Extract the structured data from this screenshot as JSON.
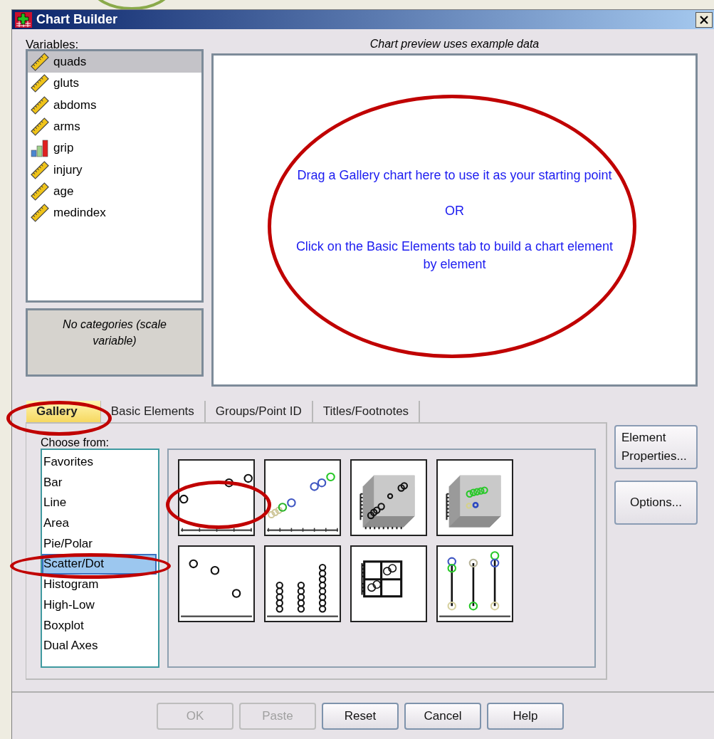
{
  "window": {
    "title": "Chart Builder"
  },
  "variables": {
    "label": "Variables:",
    "items": [
      {
        "name": "quads",
        "kind": "scale",
        "selected": true
      },
      {
        "name": "gluts",
        "kind": "scale",
        "selected": false
      },
      {
        "name": "abdoms",
        "kind": "scale",
        "selected": false
      },
      {
        "name": "arms",
        "kind": "scale",
        "selected": false
      },
      {
        "name": "grip",
        "kind": "ordinal",
        "selected": false
      },
      {
        "name": "injury",
        "kind": "scale",
        "selected": false
      },
      {
        "name": "age",
        "kind": "scale",
        "selected": false
      },
      {
        "name": "medindex",
        "kind": "scale",
        "selected": false
      }
    ],
    "categories_note": "No categories (scale variable)"
  },
  "preview": {
    "caption": "Chart preview uses example data",
    "lines": [
      "Drag a Gallery chart here to use it as your starting point",
      "OR",
      "Click on the Basic Elements tab to build a chart element by element"
    ]
  },
  "tabs": [
    {
      "label": "Gallery",
      "selected": true
    },
    {
      "label": "Basic Elements",
      "selected": false
    },
    {
      "label": "Groups/Point ID",
      "selected": false
    },
    {
      "label": "Titles/Footnotes",
      "selected": false
    }
  ],
  "gallery": {
    "label": "Choose from:",
    "types": [
      {
        "label": "Favorites",
        "selected": false
      },
      {
        "label": "Bar",
        "selected": false
      },
      {
        "label": "Line",
        "selected": false
      },
      {
        "label": "Area",
        "selected": false
      },
      {
        "label": "Pie/Polar",
        "selected": false
      },
      {
        "label": "Scatter/Dot",
        "selected": true
      },
      {
        "label": "Histogram",
        "selected": false
      },
      {
        "label": "High-Low",
        "selected": false
      },
      {
        "label": "Boxplot",
        "selected": false
      },
      {
        "label": "Dual Axes",
        "selected": false
      }
    ],
    "thumbnails": [
      {
        "kind": "scatter"
      },
      {
        "kind": "grouped"
      },
      {
        "kind": "cube"
      },
      {
        "kind": "groupedcube"
      },
      {
        "kind": "points"
      },
      {
        "kind": "dots"
      },
      {
        "kind": "matrix"
      },
      {
        "kind": "dropline"
      }
    ]
  },
  "side_buttons": [
    "Element Properties...",
    "Options..."
  ],
  "buttons": [
    {
      "label": "OK",
      "disabled": true
    },
    {
      "label": "Paste",
      "disabled": true
    },
    {
      "label": "Reset",
      "disabled": false
    },
    {
      "label": "Cancel",
      "disabled": false
    },
    {
      "label": "Help",
      "disabled": false
    }
  ]
}
